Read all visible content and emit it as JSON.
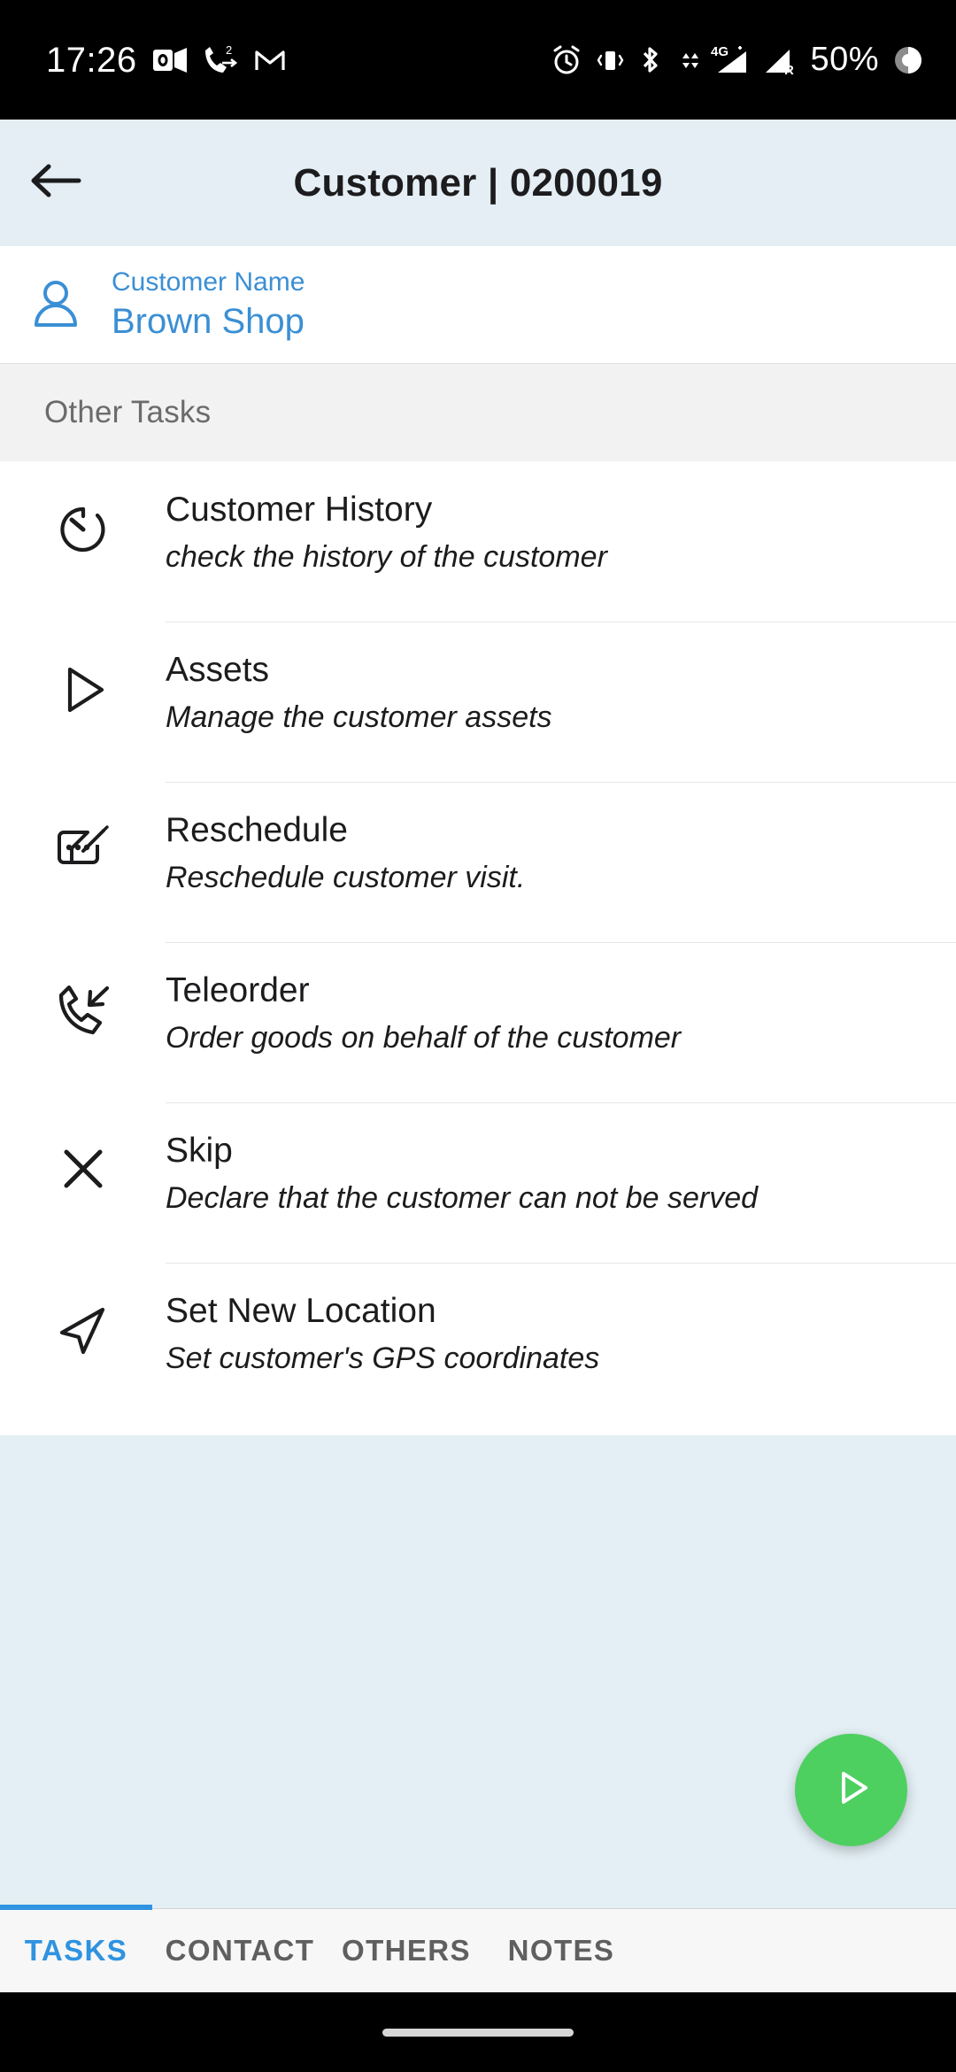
{
  "statusbar": {
    "time": "17:26",
    "battery_percent": "50%",
    "left_icons": [
      {
        "name": "outlook-icon"
      },
      {
        "name": "missed-call-icon",
        "badge": "2"
      },
      {
        "name": "gmail-icon"
      }
    ],
    "right_icons": [
      {
        "name": "alarm-icon"
      },
      {
        "name": "vibrate-icon"
      },
      {
        "name": "bluetooth-icon"
      },
      {
        "name": "signal-4g-plus-icon",
        "label": "4G+"
      },
      {
        "name": "signal-roaming-icon",
        "label": "R"
      },
      {
        "name": "battery-circle-icon"
      }
    ]
  },
  "appbar": {
    "back_icon": "arrow-left-icon",
    "title": "Customer | 0200019"
  },
  "customer": {
    "icon": "person-icon",
    "label": "Customer Name",
    "value": "Brown Shop",
    "accent_color": "#3b8fd4"
  },
  "section": {
    "title": "Other Tasks"
  },
  "tasks": [
    {
      "icon": "stopwatch-icon",
      "title": "Customer History",
      "subtitle": "check the history of the customer"
    },
    {
      "icon": "play-triangle-icon",
      "title": "Assets",
      "subtitle": "Manage the customer assets"
    },
    {
      "icon": "rate-review-edit-icon",
      "title": "Reschedule",
      "subtitle": "Reschedule customer visit."
    },
    {
      "icon": "phone-callback-icon",
      "title": "Teleorder",
      "subtitle": "Order goods on behalf of the customer"
    },
    {
      "icon": "close-x-icon",
      "title": "Skip",
      "subtitle": "Declare that the customer can not be served"
    },
    {
      "icon": "navigation-arrow-icon",
      "title": "Set New Location",
      "subtitle": "Set customer's GPS coordinates"
    }
  ],
  "fab": {
    "icon": "play-triangle-icon",
    "color": "#4ed061"
  },
  "tabs": [
    {
      "label": "TASKS",
      "active": true
    },
    {
      "label": "CONTACT",
      "active": false
    },
    {
      "label": "OTHERS",
      "active": false
    },
    {
      "label": "NOTES",
      "active": false
    }
  ],
  "navbar": {
    "handle": "gesture-pill"
  }
}
